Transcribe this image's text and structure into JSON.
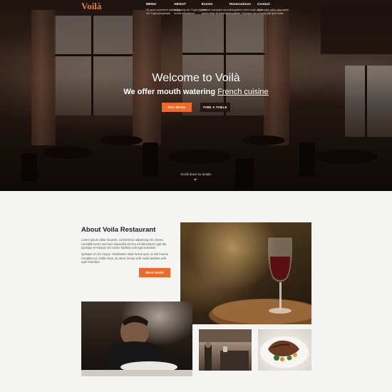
{
  "brand": {
    "logo": "Voilà",
    "accent_color": "#ee6a2c"
  },
  "nav": [
    {
      "title": "MENU",
      "desc": "Sit amet consetetur adipiscing elit. Fugit perspiciatis."
    },
    {
      "title": "ABOUT",
      "desc": "Adipiscing elit. Fugit pigiunm omnes asimaticus."
    },
    {
      "title": "Events",
      "desc": "Natione marquiam bonus ipsum dolor sit amet tatur."
    },
    {
      "title": "Reservations",
      "desc": "Voluptatem animi nobis culpa cupiditate. Dolorque ipa."
    },
    {
      "title": "Contact",
      "desc": "Quis nobis odio culpa animi volupta quis ipsa nobis."
    }
  ],
  "hero": {
    "title": "Welcome to Voilà",
    "subtitle_prefix": "We offer mouth watering",
    "subtitle_link": "French cuisine",
    "btn_menu": "SEE MENU",
    "btn_table": "FIND A TABLE",
    "scroll_hint": "Scroll down for details",
    "scroll_icon": "chevron-down-icon"
  },
  "about": {
    "title": "About Voila Restaurant",
    "paragraph1": "Lorem ipsum dolor sit amet, consectetur adipiscing elit. Donec convallis lorem sed sem imperdiet viverra condimentum eget dui. Quisque et tempor orci luctus facilisis velit eget interdum.",
    "paragraph2": "Quisque et orci neque. Vestibulum vitae luctus quis, ut nisl mauris. Curabitur at, mollis risus, sit amet, lectus velit. Nulla facilisis velit eget interdum.",
    "read_more": "READ MORE"
  }
}
